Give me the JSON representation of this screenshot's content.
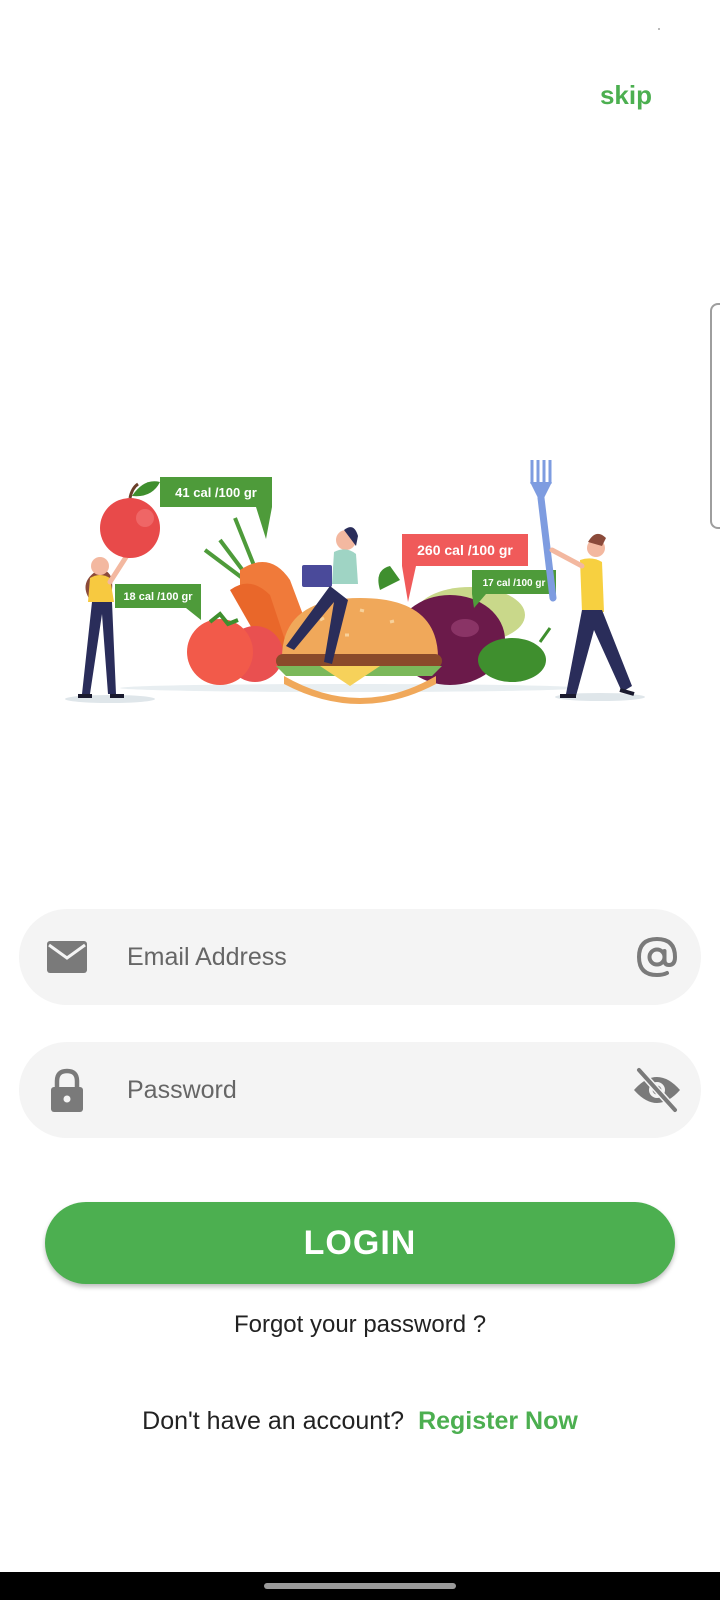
{
  "header": {
    "skip_label": "skip"
  },
  "illustration": {
    "tags": {
      "apple": "41 cal /100 gr",
      "tomato": "18 cal /100 gr",
      "burger": "260 cal /100 gr",
      "eggplant": "17 cal /100 gr"
    }
  },
  "form": {
    "email": {
      "placeholder": "Email Address",
      "value": ""
    },
    "password": {
      "placeholder": "Password",
      "value": ""
    }
  },
  "actions": {
    "login_label": "LOGIN",
    "forgot_label": "Forgot your password ?",
    "no_account_text": "Don't have an account?",
    "register_label": "Register Now"
  },
  "colors": {
    "accent": "#4caf50",
    "field_bg": "#f4f4f4",
    "icon_gray": "#7a7a7a"
  },
  "icons": [
    "envelope-icon",
    "at-sign-icon",
    "lock-icon",
    "eye-off-icon"
  ]
}
